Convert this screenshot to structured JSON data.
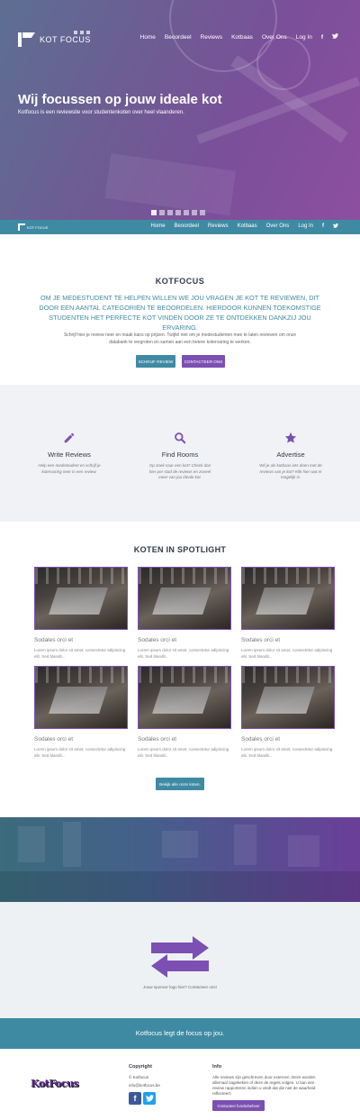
{
  "brand": {
    "name": "KOT FOCUS",
    "footer_logo": "KotFocus"
  },
  "nav": {
    "items": [
      "Home",
      "Beoordeel",
      "Reviews",
      "Kotbaas",
      "Over Ons",
      "Log In"
    ],
    "facebook_icon": "f",
    "twitter_icon": "twitter-bird"
  },
  "hero": {
    "title": "Wij focussen op jouw ideale kot",
    "subtitle": "Kotfocus is een reviewsite voor studentenkoten over heel vlaanderen.",
    "slide_count": 7,
    "active_slide": 1
  },
  "intro": {
    "title": "KOTFOCUS",
    "lead": "Om je medestudent te helpen willen we jou vragen je kot te reviewen, dit door een aantal categoriën te beoordelen. Hierdoor kunnen toekomstige studenten het perfecte kot vinden door ze te ontdekken dankzij jou ervaring.",
    "text": "Schrijf hier je review neer en maak kans op prijzen. Twijfel niet om je medestudenten mee te laten reviewen om onze databank te vergroten en samen aan een betere kotervaring te werken.",
    "btn_review": "Schrijf review",
    "btn_contact": "Contacteer ons"
  },
  "features": [
    {
      "icon": "pencil-icon",
      "title": "Write Reviews",
      "text": "Help een medestudent en schrijf je kotervaring neer in een review."
    },
    {
      "icon": "search-icon",
      "title": "Find Rooms",
      "text": "Op zoek naar een kot? Check dan hier per stad de reviews en zoveel meer van jou ideale kot."
    },
    {
      "icon": "star-icon",
      "title": "Advertise",
      "text": "Wil je als kotbaas iets doen met de reviews van je kot? Klik hier wat er mogelijk is."
    }
  ],
  "spotlight": {
    "title": "KOTEN IN SPOTLIGHT",
    "cards": [
      {
        "title": "Sodales orci et",
        "text": "Lorem ipsum dolor sit amet, consectetur adipiscing elit. Sed blandit..."
      },
      {
        "title": "Sodales orci et",
        "text": "Lorem ipsum dolor sit amet, consectetur adipiscing elit. Sed blandit..."
      },
      {
        "title": "Sodales orci et",
        "text": "Lorem ipsum dolor sit amet, consectetur adipiscing elit. Sed blandit..."
      },
      {
        "title": "Sodales orci et",
        "text": "Lorem ipsum dolor sit amet, consectetur adipiscing elit. Sed blandit..."
      },
      {
        "title": "Sodales orci et",
        "text": "Lorem ipsum dolor sit amet, consectetur adipiscing elit. Sed blandit..."
      },
      {
        "title": "Sodales orci et",
        "text": "Lorem ipsum dolor sit amet, consectetur adipiscing elit. Sed blandit..."
      }
    ],
    "btn_all": "Bekijk alle onze koten."
  },
  "sponsor": {
    "text": "Jouw sponsor logo hier? Contacteer ons!"
  },
  "tagline": "Kotfocus legt de focus op jou.",
  "footer": {
    "copyright": {
      "heading": "Copyright",
      "owner": "© Kotfocus",
      "email": "info@kotfocus.be"
    },
    "info": {
      "heading": "Info",
      "text": "Alle reviews zijn geschreven door externen. Deze worden allemaal nagekeken of deze de regels volgen. U kan een review rapporteren indien u vindt dat die niet de waarheid reflecteert.",
      "button": "Contacteer functiebeheer"
    }
  },
  "colors": {
    "teal": "#3f8aa3",
    "purple": "#7c4fb2",
    "dark": "#2f3c4d"
  }
}
